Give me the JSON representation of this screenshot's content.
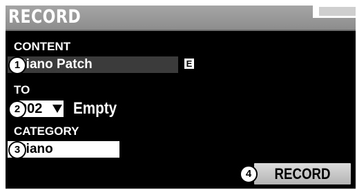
{
  "window": {
    "title": "RECORD"
  },
  "content": {
    "label": "CONTENT",
    "value": "Piano Patch",
    "edited_badge": "E",
    "step": "1"
  },
  "to": {
    "label": "TO",
    "number": "002",
    "name": "Empty",
    "step": "2"
  },
  "category": {
    "label": "CATEGORY",
    "value": "Piano",
    "step": "3"
  },
  "record_button": {
    "label": "RECORD",
    "step": "4"
  },
  "colors": {
    "background": "#000000",
    "title_bar": "#9b9b9b",
    "selected_field": "#ffffff",
    "content_field": "#3b3b3b",
    "button": "#c8c8c8"
  }
}
